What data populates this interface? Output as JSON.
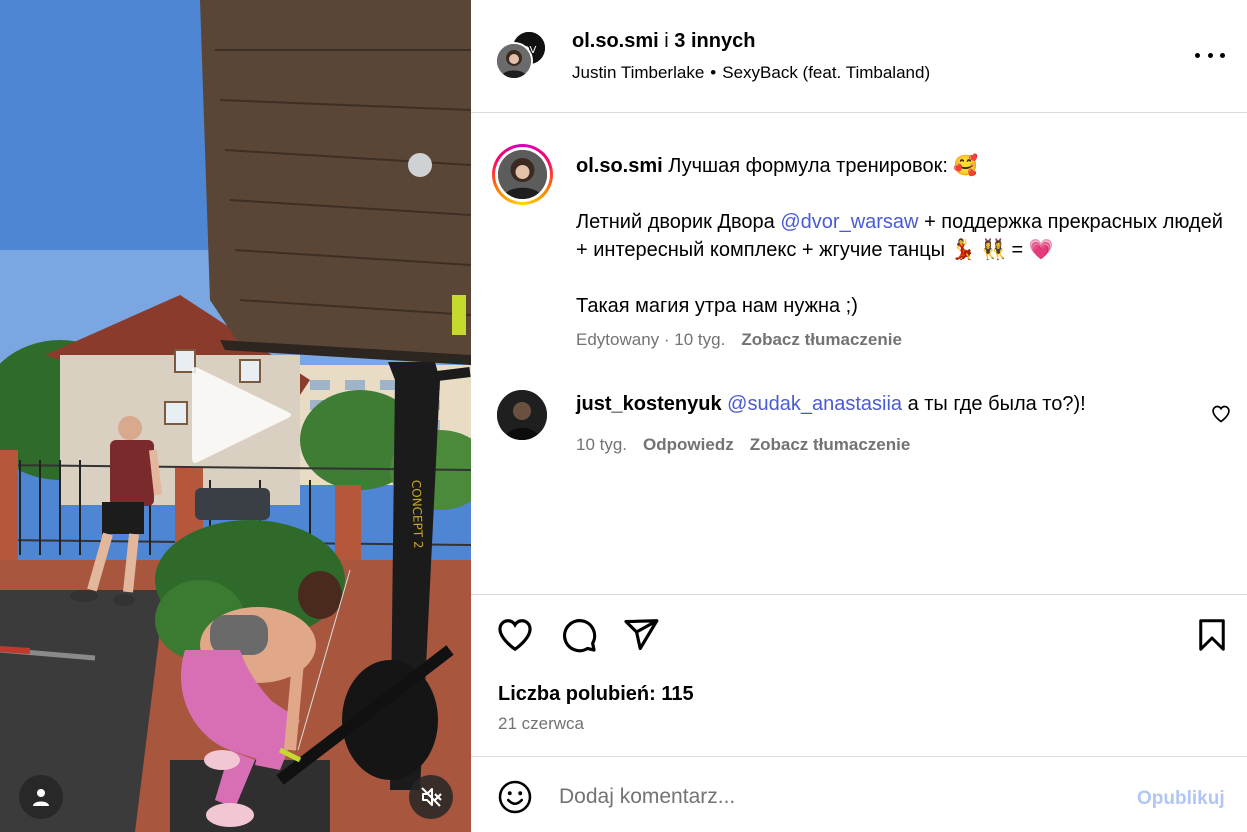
{
  "post": {
    "owner": "ol.so.smi",
    "owner_separator": "i",
    "collaborators": "3 innych",
    "music_artist": "Justin Timberlake",
    "music_dot": "•",
    "music_track": "SexyBack (feat. Timbaland)"
  },
  "media": {
    "type": "video",
    "sign_brand": "CONCEPT 2"
  },
  "caption": {
    "username": "ol.so.smi",
    "line1": "Лучшая формула тренировок: 🥰",
    "line2_pre": "Летний дворик Двора",
    "line2_mention": "@dvor_warsaw",
    "line2_post": "+ поддержка прекрасных людей + интересный комплекс + жгучие танцы 💃 👯‍♀️ = 💗",
    "line3": "Такая магия утра нам нужна ;)",
    "edited": "Edytowany",
    "time": "10 tyg.",
    "translate": "Zobacz tłumaczenie"
  },
  "comments": [
    {
      "username": "just_kostenyuk",
      "mention": "@sudak_anastasiia",
      "text": "а ты где была то?)!",
      "time": "10 tyg.",
      "reply": "Odpowiedz",
      "translate": "Zobacz tłumaczenie"
    }
  ],
  "stats": {
    "likes_label": "Liczba polubień: 115",
    "date": "21 czerwca"
  },
  "composer": {
    "placeholder": "Dodaj komentarz...",
    "publish": "Opublikuj"
  },
  "icons": {
    "like": "heart-icon",
    "comment": "comment-bubble-icon",
    "share": "paper-plane-icon",
    "save": "bookmark-icon",
    "more": "more-horizontal-icon",
    "emoji": "emoji-smile-icon",
    "play": "play-icon",
    "user": "user-tag-icon",
    "mute": "speaker-muted-icon"
  },
  "colors": {
    "mention": "#4a5bd3",
    "secondary_text": "#737373",
    "divider": "#dbdbdb",
    "publish_disabled": "#b2c6f5"
  }
}
